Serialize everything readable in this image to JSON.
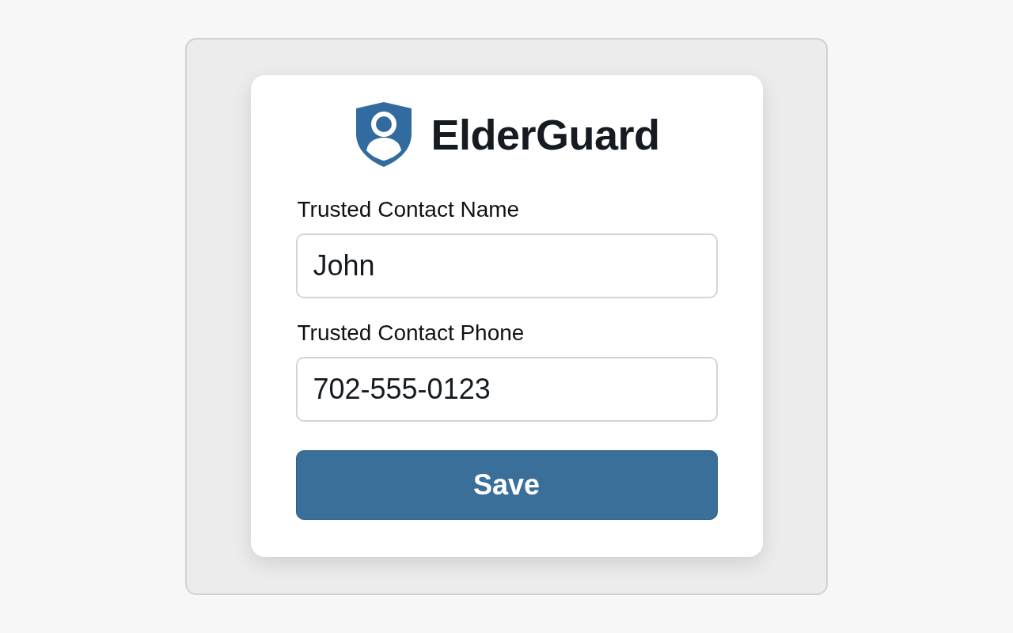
{
  "brand": {
    "name": "ElderGuard"
  },
  "fields": [
    {
      "label": "Trusted Contact Name",
      "value": "John"
    },
    {
      "label": "Trusted Contact Phone",
      "value": "702-555-0123"
    }
  ],
  "button": {
    "label": "Save"
  }
}
